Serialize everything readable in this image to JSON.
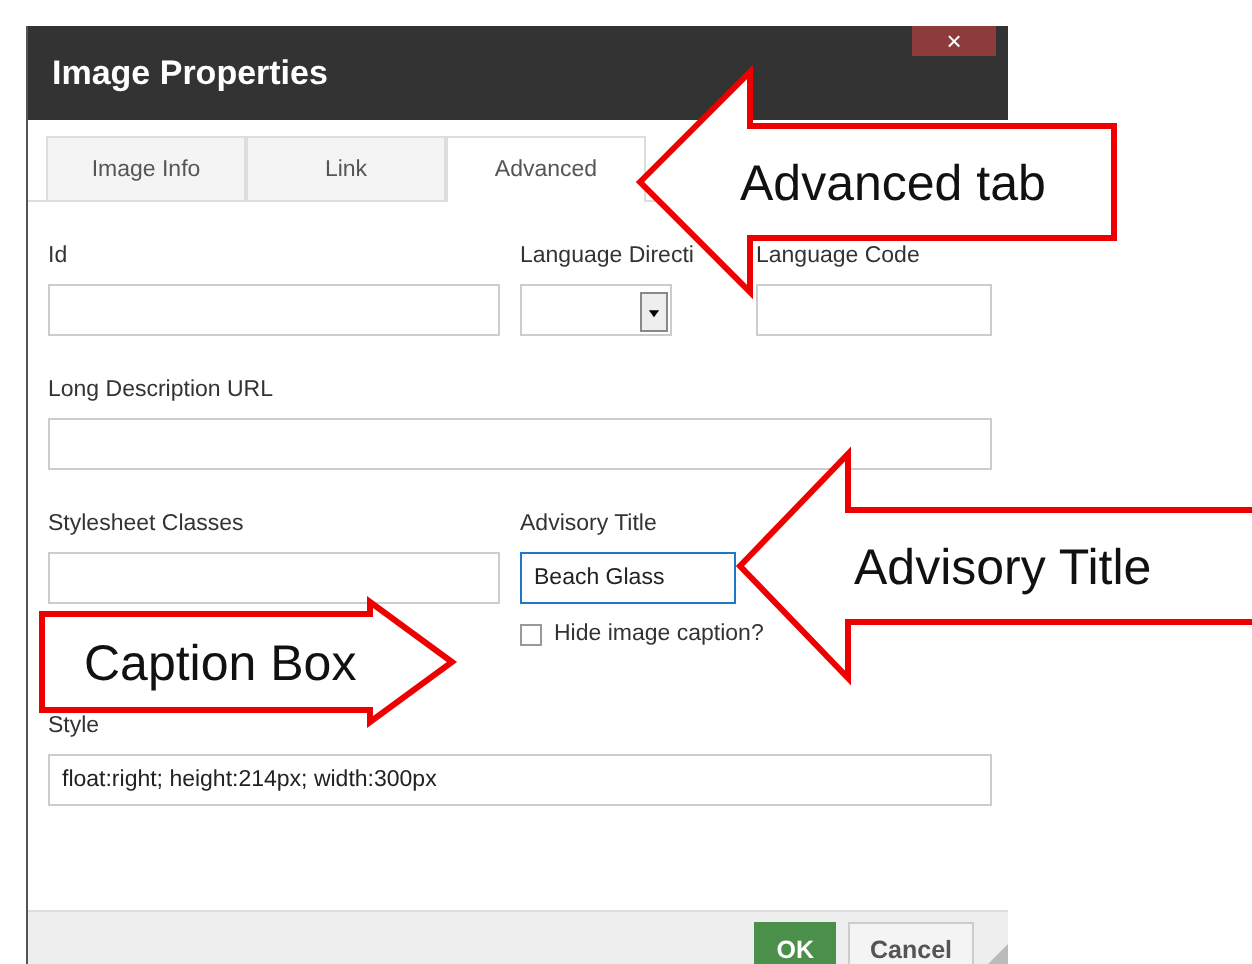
{
  "window": {
    "title": "Image Properties",
    "close": "×"
  },
  "tabs": [
    {
      "label": "Image Info",
      "selected": false
    },
    {
      "label": "Link",
      "selected": false
    },
    {
      "label": "Advanced",
      "selected": true
    }
  ],
  "fields": {
    "id": {
      "label": "Id"
    },
    "language_direction": {
      "label": "Language Directi"
    },
    "language_code": {
      "label": "Language Code"
    },
    "long_description_url": {
      "label": "Long Description URL"
    },
    "stylesheet_classes": {
      "label": "Stylesheet Classes"
    },
    "advisory_title": {
      "label": "Advisory Title",
      "value": "Beach Glass",
      "focused": true
    },
    "hide_caption": {
      "label": "Hide image caption?",
      "checked": false
    },
    "style": {
      "label": "Style",
      "value": "float:right; height:214px; width:300px"
    }
  },
  "buttons": [
    {
      "label": "OK",
      "kind": "primary"
    },
    {
      "label": "Cancel",
      "kind": "secondary"
    }
  ],
  "callouts": [
    {
      "label": "Advanced tab"
    },
    {
      "label": "Advisory Title"
    },
    {
      "label": "Caption Box"
    }
  ]
}
